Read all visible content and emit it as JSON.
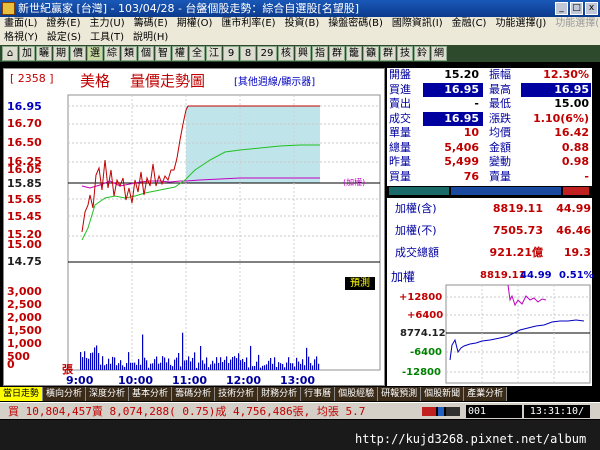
{
  "window": {
    "title": "新世紀贏家 [台灣] - 103/04/28 - 台盤個股走勢：綜合自選股[名望股]",
    "btn_min": "_",
    "btn_max": "□",
    "btn_close": "x"
  },
  "menu": {
    "row1": [
      "畫面(L)",
      "證券(E)",
      "主力(U)",
      "籌碼(E)",
      "期權(O)",
      "匯市利率(E)",
      "投資(B)",
      "操盤密碼(B)",
      "國際資訊(I)",
      "金融(C)",
      "功能選擇(J)",
      "功能選擇(K)"
    ],
    "row2": [
      "格視(Y)",
      "設定(S)",
      "工具(T)",
      "說明(H)"
    ]
  },
  "toolbar": [
    "加",
    "曬",
    "期",
    "價",
    "選",
    "綜",
    "類",
    "個",
    "智",
    "權",
    "全",
    "江",
    "9",
    "8",
    "29",
    "核",
    "興",
    "指",
    "群",
    "籠",
    "籲",
    "群",
    "技",
    "鈴",
    "網"
  ],
  "header": {
    "code": "[ 2358 ]",
    "name": "美格",
    "title": "量價走勢圖",
    "period": "[其他週線/顯示器]"
  },
  "price_axis": {
    "ticks": [
      "16.95",
      "16.70",
      "16.50",
      "16.25",
      "16.05",
      "15.85",
      "15.65",
      "15.45",
      "15.20",
      "15.00",
      "14.75"
    ],
    "ref_label": "(加權)"
  },
  "volume_axis": {
    "ticks": [
      "3,000",
      "2,500",
      "2,000",
      "1,500",
      "1,000",
      "500",
      "0"
    ],
    "unit": "張"
  },
  "time_axis": [
    "9:00",
    "10:00",
    "11:00",
    "12:00",
    "13:00"
  ],
  "predict_label": "預測",
  "quote": {
    "left": [
      {
        "label": "開盤",
        "value": "15.20"
      },
      {
        "label": "買進",
        "value": "16.95"
      },
      {
        "label": "賣出",
        "value": "-"
      },
      {
        "label": "成交",
        "value": "16.95"
      },
      {
        "label": "單量",
        "value": "10"
      },
      {
        "label": "總量",
        "value": "5,406"
      },
      {
        "label": "昨量",
        "value": "5,499"
      },
      {
        "label": "買量",
        "value": "76"
      }
    ],
    "right": [
      {
        "label": "振幅",
        "value": "12.30%"
      },
      {
        "label": "最高",
        "value": "16.95"
      },
      {
        "label": "最低",
        "value": "15.00"
      },
      {
        "label": "漲跌",
        "value": "1.10(6%)"
      },
      {
        "label": "均價",
        "value": "16.42"
      },
      {
        "label": "金額",
        "value": "0.88"
      },
      {
        "label": "變動",
        "value": "0.98"
      },
      {
        "label": "賣量",
        "value": "-"
      }
    ]
  },
  "index": [
    {
      "label": "加權(含)",
      "v1": "8819.11",
      "v2": "44.99"
    },
    {
      "label": "加權(不)",
      "v1": "7505.73",
      "v2": "46.46"
    },
    {
      "label": "成交總額",
      "v1": "921.21億",
      "v2": "19.3"
    }
  ],
  "mini": {
    "label": "加權",
    "v1": "8819.11",
    "v2": "44.99",
    "v3": "0.51%",
    "ticks": [
      "+12800",
      "+6400",
      "8774.12",
      "-6400",
      "-12800"
    ]
  },
  "tabs": [
    "當日走勢",
    "橫向分析",
    "深度分析",
    "基本分析",
    "籌碼分析",
    "技術分析",
    "財務分析",
    "行事曆",
    "個股經驗",
    "研報預測",
    "個股新聞",
    "產業分析"
  ],
  "status": {
    "text": "買 10,804,457賣 8,074,288( 0.75)成 4,756,486張, 均張 5.7",
    "box": "001",
    "time": "13:31:10/"
  },
  "watermark": "http://kujd3268.pixnet.net/album"
}
